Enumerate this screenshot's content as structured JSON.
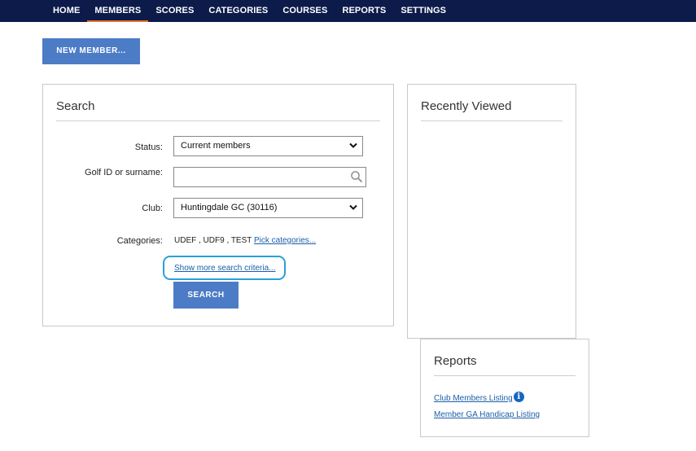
{
  "nav": {
    "items": [
      {
        "label": "HOME"
      },
      {
        "label": "MEMBERS",
        "active": true
      },
      {
        "label": "SCORES"
      },
      {
        "label": "CATEGORIES"
      },
      {
        "label": "COURSES"
      },
      {
        "label": "REPORTS"
      },
      {
        "label": "SETTINGS"
      }
    ]
  },
  "toolbar": {
    "new_member_label": "NEW MEMBER..."
  },
  "search": {
    "title": "Search",
    "status_label": "Status:",
    "status_value": "Current members",
    "golf_id_label": "Golf ID or surname:",
    "golf_id_value": "",
    "club_label": "Club:",
    "club_value": "Huntingdale GC (30116)",
    "categories_label": "Categories:",
    "categories_value": "UDEF , UDF9 , TEST",
    "pick_categories_link": "Pick categories...",
    "more_criteria_link": "Show more search criteria...",
    "search_button": "SEARCH"
  },
  "recently_viewed": {
    "title": "Recently Viewed"
  },
  "reports": {
    "title": "Reports",
    "links": [
      "Club Members Listing",
      "Member GA Handicap Listing"
    ]
  },
  "colors": {
    "nav_bg": "#0d1b4b",
    "active_underline": "#e8702a",
    "button": "#4d7cc6",
    "link": "#1a5fa8",
    "highlight": "#2aa0d8"
  }
}
